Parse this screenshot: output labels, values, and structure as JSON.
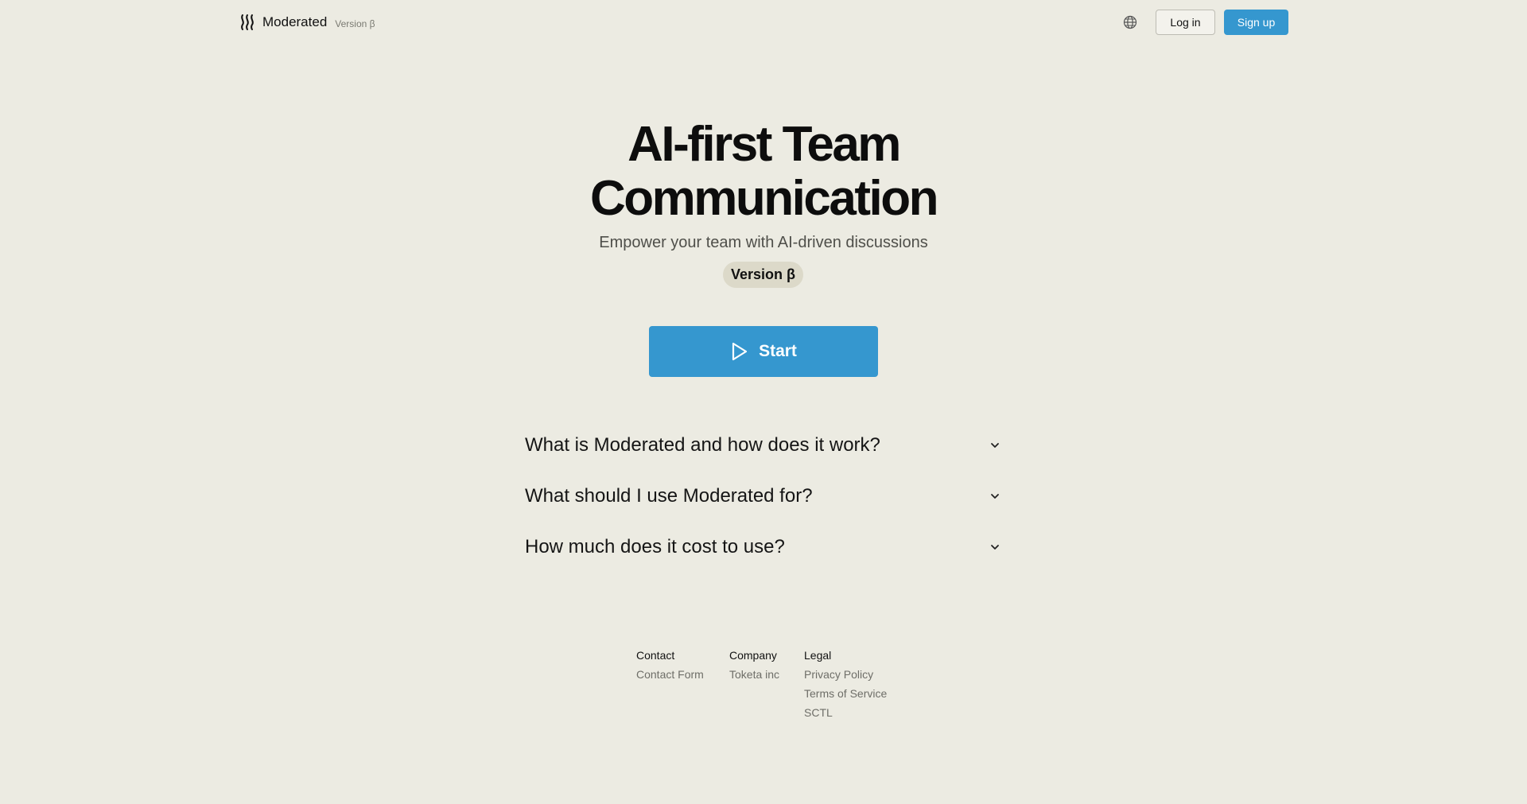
{
  "header": {
    "brand_name": "Moderated",
    "brand_version": "Version β",
    "language_icon": "globe-icon",
    "login_label": "Log in",
    "signup_label": "Sign up"
  },
  "hero": {
    "title_line1": "AI-first Team",
    "title_line2": "Communication",
    "subtitle": "Empower your team with AI-driven discussions",
    "version_badge": "Version β",
    "start_label": "Start",
    "start_icon": "play-icon"
  },
  "faq": [
    {
      "question": "What is Moderated and how does it work?"
    },
    {
      "question": "What should I use Moderated for?"
    },
    {
      "question": "How much does it cost to use?"
    }
  ],
  "footer": {
    "contact": {
      "heading": "Contact",
      "links": [
        "Contact Form"
      ]
    },
    "company": {
      "heading": "Company",
      "links": [
        "Toketa inc"
      ]
    },
    "legal": {
      "heading": "Legal",
      "links": [
        "Privacy Policy",
        "Terms of Service",
        "SCTL"
      ]
    }
  },
  "colors": {
    "background": "#ecebe2",
    "accent": "#3597cf",
    "badge_bg": "#dcd9c9",
    "text": "#111111",
    "muted": "#6e6e68"
  }
}
